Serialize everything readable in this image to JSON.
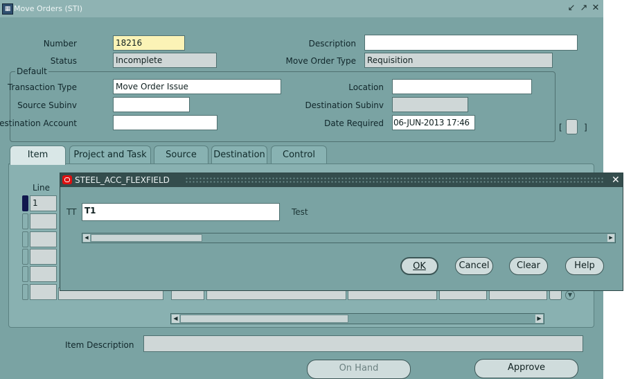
{
  "window": {
    "title": "Move Orders (STI)"
  },
  "header": {
    "number_label": "Number",
    "number_value": "18216",
    "status_label": "Status",
    "status_value": "Incomplete",
    "description_label": "Description",
    "description_value": "",
    "move_order_type_label": "Move Order Type",
    "move_order_type_value": "Requisition"
  },
  "default": {
    "legend": "Default",
    "transaction_type_label": "Transaction Type",
    "transaction_type_value": "Move Order Issue",
    "source_subinv_label": "Source Subinv",
    "source_subinv_value": "",
    "destination_account_label": "Destination Account",
    "destination_account_value": "",
    "location_label": "Location",
    "location_value": "",
    "destination_subinv_label": "Destination Subinv",
    "destination_subinv_value": "",
    "date_required_label": "Date Required",
    "date_required_value": "06-JUN-2013 17:46",
    "bracket_left": "[",
    "bracket_right": "]"
  },
  "tabs": [
    "Item",
    "Project and Task",
    "Source",
    "Destination",
    "Control"
  ],
  "grid": {
    "line_header": "Line",
    "rows": [
      "1",
      "",
      "",
      "",
      "",
      ""
    ]
  },
  "dialog": {
    "title": "STEEL_ACC_FLEXFIELD",
    "field_label": "TT",
    "field_value": "T1",
    "field_desc": "Test",
    "buttons": {
      "ok": "OK",
      "cancel": "Cancel",
      "clear": "Clear",
      "help": "Help"
    }
  },
  "footer": {
    "item_description_label": "Item Description",
    "item_description_value": "",
    "on_hand": "On Hand",
    "approve": "Approve"
  }
}
